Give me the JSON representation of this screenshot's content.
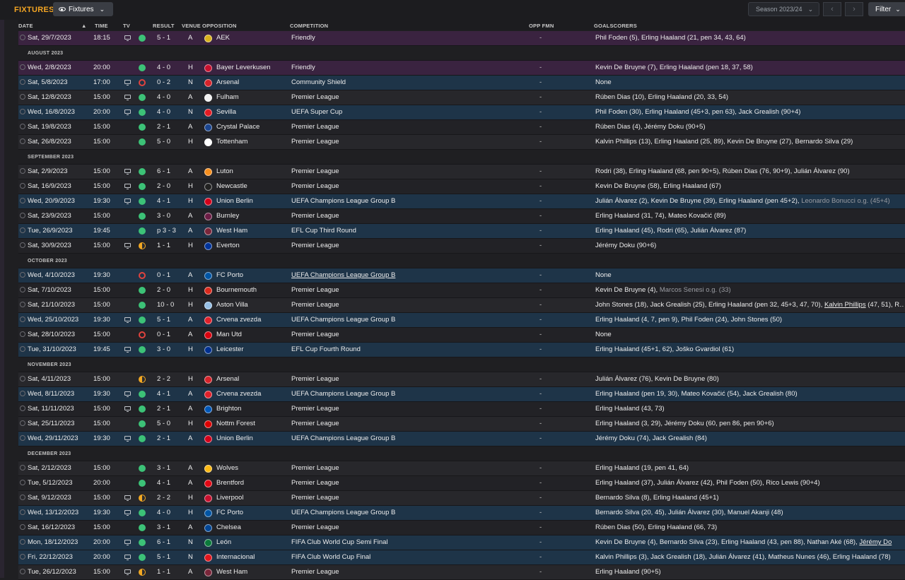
{
  "header": {
    "title": "FIXTURES",
    "view_label": "Fixtures",
    "season_label": "Season 2023/24",
    "filter_label": "Filter"
  },
  "columns": {
    "date": "DATE",
    "time": "TIME",
    "tv": "TV",
    "result": "RESULT",
    "venue": "VENUE",
    "opposition": "OPPOSITION",
    "competition": "COMPETITION",
    "opp_fmn": "OPP FMN",
    "goalscorers": "GOALSCORERS"
  },
  "colors": {
    "accent": "#f5a623",
    "win": "#3cc277",
    "loss": "#e0433e",
    "draw": "#f2a823",
    "european_row": "#1e3448",
    "friendly_row": "#3a2340"
  },
  "rows": [
    {
      "kind": "match",
      "date": "Sat, 29/7/2023",
      "time": "18:15",
      "tv": true,
      "res": "win",
      "score": "5 - 1",
      "venue": "A",
      "opp": "AEK",
      "crest": "#d9b21c",
      "comp": "Friendly",
      "fmn": "-",
      "goals": "Phil Foden (5), Erling Haaland (21, pen 34, 43, 64)",
      "style": "fr"
    },
    {
      "kind": "month",
      "label": "AUGUST 2023"
    },
    {
      "kind": "match",
      "date": "Wed, 2/8/2023",
      "time": "20:00",
      "tv": false,
      "res": "win",
      "score": "4 - 0",
      "venue": "H",
      "opp": "Bayer Leverkusen",
      "crest": "#c8102e",
      "comp": "Friendly",
      "fmn": "-",
      "goals": "Kevin De Bruyne (7), Erling Haaland (pen 18, 37, 58)",
      "style": "fr"
    },
    {
      "kind": "match",
      "date": "Sat, 5/8/2023",
      "time": "17:00",
      "tv": true,
      "res": "loss",
      "score": "0 - 2",
      "venue": "N",
      "opp": "Arsenal",
      "crest": "#d5232a",
      "comp": "Community Shield",
      "fmn": "-",
      "goals": "None",
      "style": "eu"
    },
    {
      "kind": "match",
      "date": "Sat, 12/8/2023",
      "time": "15:00",
      "tv": true,
      "res": "win",
      "score": "4 - 0",
      "venue": "A",
      "opp": "Fulham",
      "crest": "#f2f2f2",
      "comp": "Premier League",
      "fmn": "-",
      "goals": "Rúben Dias (10), Erling Haaland (20, 33, 54)",
      "style": "even"
    },
    {
      "kind": "match",
      "date": "Wed, 16/8/2023",
      "time": "20:00",
      "tv": true,
      "res": "win",
      "score": "4 - 0",
      "venue": "N",
      "opp": "Sevilla",
      "crest": "#e31b23",
      "comp": "UEFA Super Cup",
      "fmn": "-",
      "goals": "Phil Foden (30), Erling Haaland (45+3, pen 63), Jack Grealish (90+4)",
      "style": "eu"
    },
    {
      "kind": "match",
      "date": "Sat, 19/8/2023",
      "time": "15:00",
      "tv": false,
      "res": "win",
      "score": "2 - 1",
      "venue": "A",
      "opp": "Crystal Palace",
      "crest": "#1b458f",
      "comp": "Premier League",
      "fmn": "-",
      "goals": "Rúben Dias (4), Jérémy Doku (90+5)",
      "style": "odd"
    },
    {
      "kind": "match",
      "date": "Sat, 26/8/2023",
      "time": "15:00",
      "tv": false,
      "res": "win",
      "score": "5 - 0",
      "venue": "H",
      "opp": "Tottenham",
      "crest": "#ffffff",
      "comp": "Premier League",
      "fmn": "-",
      "goals": "Kalvin Phillips (13), Erling Haaland (25, 89), Kevin De Bruyne (27), Bernardo Silva (29)",
      "style": "even"
    },
    {
      "kind": "month",
      "label": "SEPTEMBER 2023"
    },
    {
      "kind": "match",
      "date": "Sat, 2/9/2023",
      "time": "15:00",
      "tv": true,
      "res": "win",
      "score": "6 - 1",
      "venue": "A",
      "opp": "Luton",
      "crest": "#f78f1e",
      "comp": "Premier League",
      "fmn": "-",
      "goals": "Rodri (38), Erling Haaland (68, pen 90+5), Rúben Dias (76, 90+9), Julián Álvarez (90)",
      "style": "even"
    },
    {
      "kind": "match",
      "date": "Sat, 16/9/2023",
      "time": "15:00",
      "tv": true,
      "res": "win",
      "score": "2 - 0",
      "venue": "H",
      "opp": "Newcastle",
      "crest": "#222222",
      "comp": "Premier League",
      "fmn": "-",
      "goals": "Kevin De Bruyne (58), Erling Haaland (67)",
      "style": "odd"
    },
    {
      "kind": "match",
      "date": "Wed, 20/9/2023",
      "time": "19:30",
      "tv": true,
      "res": "win",
      "score": "4 - 1",
      "venue": "H",
      "opp": "Union Berlin",
      "crest": "#d4001a",
      "comp": "UEFA Champions League Group B",
      "fmn": "-",
      "goals": "Julián Álvarez (2), Kevin De Bruyne (39), Erling Haaland (pen 45+2),",
      "og": "Leonardo Bonucci o.g. (45+4)",
      "style": "eu"
    },
    {
      "kind": "match",
      "date": "Sat, 23/9/2023",
      "time": "15:00",
      "tv": false,
      "res": "win",
      "score": "3 - 0",
      "venue": "A",
      "opp": "Burnley",
      "crest": "#6c1d45",
      "comp": "Premier League",
      "fmn": "-",
      "goals": "Erling Haaland (31, 74), Mateo Kovačić (89)",
      "style": "odd"
    },
    {
      "kind": "match",
      "date": "Tue, 26/9/2023",
      "time": "19:45",
      "tv": false,
      "res": "win",
      "score": "p 3 - 3",
      "venue": "A",
      "opp": "West Ham",
      "crest": "#7a263a",
      "comp": "EFL Cup Third Round",
      "fmn": "-",
      "goals": "Erling Haaland (45), Rodri (65), Julián Álvarez (87)",
      "style": "eu"
    },
    {
      "kind": "match",
      "date": "Sat, 30/9/2023",
      "time": "15:00",
      "tv": true,
      "res": "draw",
      "score": "1 - 1",
      "venue": "H",
      "opp": "Everton",
      "crest": "#003399",
      "comp": "Premier League",
      "fmn": "-",
      "goals": "Jérémy Doku (90+6)",
      "style": "odd"
    },
    {
      "kind": "month",
      "label": "OCTOBER 2023"
    },
    {
      "kind": "match",
      "date": "Wed, 4/10/2023",
      "time": "19:30",
      "tv": false,
      "res": "loss",
      "score": "0 - 1",
      "venue": "A",
      "opp": "FC Porto",
      "crest": "#0055a4",
      "comp": "UEFA Champions League Group B",
      "comp_ul": true,
      "fmn": "-",
      "goals": "None",
      "style": "eu"
    },
    {
      "kind": "match",
      "date": "Sat, 7/10/2023",
      "time": "15:00",
      "tv": false,
      "res": "win",
      "score": "2 - 0",
      "venue": "H",
      "opp": "Bournemouth",
      "crest": "#da291c",
      "comp": "Premier League",
      "fmn": "-",
      "goals": "Kevin De Bruyne (4),",
      "og": "Marcos Senesi o.g. (33)",
      "style": "odd"
    },
    {
      "kind": "match",
      "date": "Sat, 21/10/2023",
      "time": "15:00",
      "tv": false,
      "res": "win",
      "score": "10 - 0",
      "venue": "H",
      "opp": "Aston Villa",
      "crest": "#95bfe5",
      "comp": "Premier League",
      "fmn": "-",
      "goals": "John Stones (18), Jack Grealish (25), Erling Haaland (pen 32, 45+3, 47, 70),",
      "ul": "Kalvin Phillips",
      "tail": "(47, 51), R…",
      "style": "even"
    },
    {
      "kind": "match",
      "date": "Wed, 25/10/2023",
      "time": "19:30",
      "tv": true,
      "res": "win",
      "score": "5 - 1",
      "venue": "A",
      "opp": "Crvena zvezda",
      "crest": "#e0202a",
      "comp": "UEFA Champions League Group B",
      "fmn": "-",
      "goals": "Erling Haaland (4, 7, pen 9), Phil Foden (24), John Stones (50)",
      "style": "eu"
    },
    {
      "kind": "match",
      "date": "Sat, 28/10/2023",
      "time": "15:00",
      "tv": false,
      "res": "loss",
      "score": "0 - 1",
      "venue": "A",
      "opp": "Man Utd",
      "crest": "#da020e",
      "comp": "Premier League",
      "fmn": "-",
      "goals": "None",
      "style": "odd"
    },
    {
      "kind": "match",
      "date": "Tue, 31/10/2023",
      "time": "19:45",
      "tv": true,
      "res": "win",
      "score": "3 - 0",
      "venue": "H",
      "opp": "Leicester",
      "crest": "#003090",
      "comp": "EFL Cup Fourth Round",
      "fmn": "-",
      "goals": "Erling Haaland (45+1, 62), Joško Gvardiol (61)",
      "style": "eu"
    },
    {
      "kind": "month",
      "label": "NOVEMBER 2023"
    },
    {
      "kind": "match",
      "date": "Sat, 4/11/2023",
      "time": "15:00",
      "tv": false,
      "res": "draw",
      "score": "2 - 2",
      "venue": "H",
      "opp": "Arsenal",
      "crest": "#d5232a",
      "comp": "Premier League",
      "fmn": "-",
      "goals": "Julián Álvarez (76), Kevin De Bruyne (80)",
      "style": "even"
    },
    {
      "kind": "match",
      "date": "Wed, 8/11/2023",
      "time": "19:30",
      "tv": true,
      "res": "win",
      "score": "4 - 1",
      "venue": "A",
      "opp": "Crvena zvezda",
      "crest": "#e0202a",
      "comp": "UEFA Champions League Group B",
      "fmn": "-",
      "goals": "Erling Haaland (pen 19, 30), Mateo Kovačić (54), Jack Grealish (80)",
      "style": "eu"
    },
    {
      "kind": "match",
      "date": "Sat, 11/11/2023",
      "time": "15:00",
      "tv": true,
      "res": "win",
      "score": "2 - 1",
      "venue": "A",
      "opp": "Brighton",
      "crest": "#0057b8",
      "comp": "Premier League",
      "fmn": "-",
      "goals": "Erling Haaland (43, 73)",
      "style": "odd"
    },
    {
      "kind": "match",
      "date": "Sat, 25/11/2023",
      "time": "15:00",
      "tv": false,
      "res": "win",
      "score": "5 - 0",
      "venue": "H",
      "opp": "Nottm Forest",
      "crest": "#dd0000",
      "comp": "Premier League",
      "fmn": "-",
      "goals": "Erling Haaland (3, 29), Jérémy Doku (60, pen 86, pen 90+6)",
      "style": "even"
    },
    {
      "kind": "match",
      "date": "Wed, 29/11/2023",
      "time": "19:30",
      "tv": true,
      "res": "win",
      "score": "2 - 1",
      "venue": "A",
      "opp": "Union Berlin",
      "crest": "#d4001a",
      "comp": "UEFA Champions League Group B",
      "fmn": "-",
      "goals": "Jérémy Doku (74), Jack Grealish (84)",
      "style": "eu"
    },
    {
      "kind": "month",
      "label": "DECEMBER 2023"
    },
    {
      "kind": "match",
      "date": "Sat, 2/12/2023",
      "time": "15:00",
      "tv": false,
      "res": "win",
      "score": "3 - 1",
      "venue": "A",
      "opp": "Wolves",
      "crest": "#fdb913",
      "comp": "Premier League",
      "fmn": "-",
      "goals": "Erling Haaland (19, pen 41, 64)",
      "style": "even"
    },
    {
      "kind": "match",
      "date": "Tue, 5/12/2023",
      "time": "20:00",
      "tv": false,
      "res": "win",
      "score": "4 - 1",
      "venue": "A",
      "opp": "Brentford",
      "crest": "#e30613",
      "comp": "Premier League",
      "fmn": "-",
      "goals": "Erling Haaland (37), Julián Álvarez (42), Phil Foden (50), Rico Lewis (90+4)",
      "style": "odd"
    },
    {
      "kind": "match",
      "date": "Sat, 9/12/2023",
      "time": "15:00",
      "tv": true,
      "res": "draw",
      "score": "2 - 2",
      "venue": "H",
      "opp": "Liverpool",
      "crest": "#c8102e",
      "comp": "Premier League",
      "fmn": "-",
      "goals": "Bernardo Silva (8), Erling Haaland (45+1)",
      "style": "even"
    },
    {
      "kind": "match",
      "date": "Wed, 13/12/2023",
      "time": "19:30",
      "tv": true,
      "res": "win",
      "score": "4 - 0",
      "venue": "H",
      "opp": "FC Porto",
      "crest": "#0055a4",
      "comp": "UEFA Champions League Group B",
      "fmn": "-",
      "goals": "Bernardo Silva (20, 45), Julián Álvarez (30), Manuel Akanji (48)",
      "style": "eu"
    },
    {
      "kind": "match",
      "date": "Sat, 16/12/2023",
      "time": "15:00",
      "tv": false,
      "res": "win",
      "score": "3 - 1",
      "venue": "A",
      "opp": "Chelsea",
      "crest": "#034694",
      "comp": "Premier League",
      "fmn": "-",
      "goals": "Rúben Dias (50), Erling Haaland (66, 73)",
      "style": "odd"
    },
    {
      "kind": "match",
      "date": "Mon, 18/12/2023",
      "time": "20:00",
      "tv": true,
      "res": "win",
      "score": "6 - 1",
      "venue": "N",
      "opp": "León",
      "crest": "#0b7a3b",
      "comp": "FIFA Club World Cup Semi Final",
      "fmn": "-",
      "goals": "Kevin De Bruyne (4), Bernardo Silva (23), Erling Haaland (43, pen 88), Nathan Aké (68),",
      "ul": "Jérémy Do",
      "style": "eu"
    },
    {
      "kind": "match",
      "date": "Fri, 22/12/2023",
      "time": "20:00",
      "tv": true,
      "res": "win",
      "score": "5 - 1",
      "venue": "N",
      "opp": "Internacional",
      "crest": "#e1151c",
      "comp": "FIFA Club World Cup Final",
      "fmn": "-",
      "goals": "Kalvin Phillips (3), Jack Grealish (18), Julián Álvarez (41), Matheus Nunes (46), Erling Haaland (78)",
      "style": "eu"
    },
    {
      "kind": "match",
      "date": "Tue, 26/12/2023",
      "time": "15:00",
      "tv": true,
      "res": "draw",
      "score": "1 - 1",
      "venue": "A",
      "opp": "West Ham",
      "crest": "#7a263a",
      "comp": "Premier League",
      "fmn": "-",
      "goals": "Erling Haaland (90+5)",
      "style": "even"
    }
  ]
}
